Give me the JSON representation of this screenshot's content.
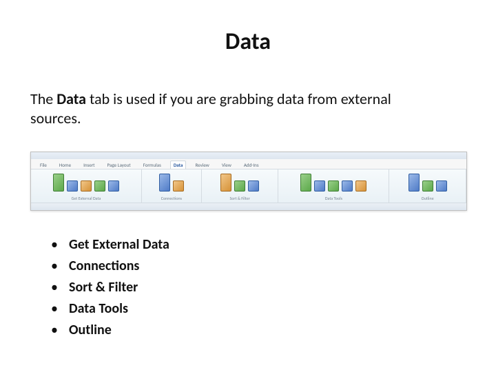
{
  "title": "Data",
  "description_pre": "The",
  "description_bold": "Data",
  "description_post": "tab is used if you are grabbing data from external sources.",
  "ribbon": {
    "tabs": [
      "File",
      "Home",
      "Insert",
      "Page Layout",
      "Formulas",
      "Data",
      "Review",
      "View",
      "Add-Ins"
    ],
    "active_tab": "Data",
    "groups": [
      {
        "label": "Get External Data",
        "icons": 5
      },
      {
        "label": "Connections",
        "icons": 2
      },
      {
        "label": "Sort & Filter",
        "icons": 3
      },
      {
        "label": "Data Tools",
        "icons": 5
      },
      {
        "label": "Outline",
        "icons": 3
      }
    ]
  },
  "bullets": [
    "Get External Data",
    "Connections",
    "Sort & Filter",
    "Data Tools",
    "Outline"
  ]
}
